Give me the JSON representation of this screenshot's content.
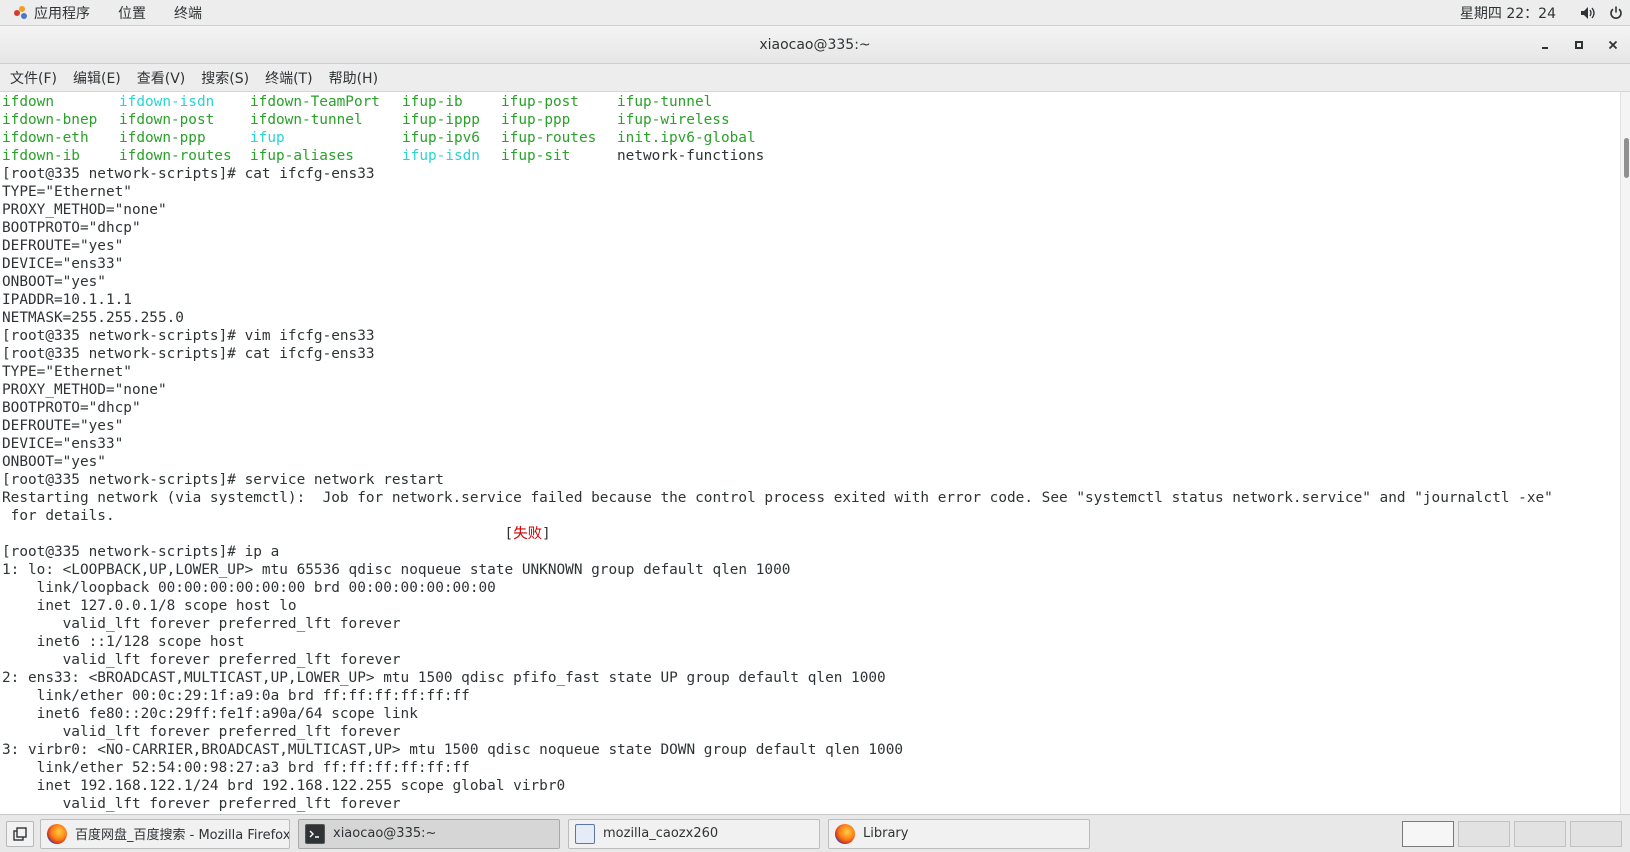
{
  "topbar": {
    "apps_label": "应用程序",
    "places_label": "位置",
    "terminal_label": "终端",
    "clock": "星期四 22：24"
  },
  "window": {
    "title": "xiaocao@335:~"
  },
  "menubar": [
    "文件(F)",
    "编辑(E)",
    "查看(V)",
    "搜索(S)",
    "终端(T)",
    "帮助(H)"
  ],
  "terminal": {
    "ls_rows": [
      [
        {
          "text": "ifdown",
          "color": "green"
        },
        {
          "text": "ifdown-isdn",
          "color": "cyan"
        },
        {
          "text": "ifdown-TeamPort",
          "color": "green"
        },
        {
          "text": "ifup-ib",
          "color": "green"
        },
        {
          "text": "ifup-post",
          "color": "green"
        },
        {
          "text": "ifup-tunnel",
          "color": "green"
        }
      ],
      [
        {
          "text": "ifdown-bnep",
          "color": "green"
        },
        {
          "text": "ifdown-post",
          "color": "green"
        },
        {
          "text": "ifdown-tunnel",
          "color": "green"
        },
        {
          "text": "ifup-ippp",
          "color": "green"
        },
        {
          "text": "ifup-ppp",
          "color": "green"
        },
        {
          "text": "ifup-wireless",
          "color": "green"
        }
      ],
      [
        {
          "text": "ifdown-eth",
          "color": "green"
        },
        {
          "text": "ifdown-ppp",
          "color": "green"
        },
        {
          "text": "ifup",
          "color": "cyan"
        },
        {
          "text": "ifup-ipv6",
          "color": "green"
        },
        {
          "text": "ifup-routes",
          "color": "green"
        },
        {
          "text": "init.ipv6-global",
          "color": "green"
        }
      ],
      [
        {
          "text": "ifdown-ib",
          "color": "green"
        },
        {
          "text": "ifdown-routes",
          "color": "green"
        },
        {
          "text": "ifup-aliases",
          "color": "green"
        },
        {
          "text": "ifup-isdn",
          "color": "cyan"
        },
        {
          "text": "ifup-sit",
          "color": "green"
        },
        {
          "text": "network-functions",
          "color": "plain"
        }
      ]
    ],
    "lines": [
      "[root@335 network-scripts]# cat ifcfg-ens33",
      "TYPE=\"Ethernet\"",
      "PROXY_METHOD=\"none\"",
      "BOOTPROTO=\"dhcp\"",
      "DEFROUTE=\"yes\"",
      "DEVICE=\"ens33\"",
      "ONBOOT=\"yes\"",
      "IPADDR=10.1.1.1",
      "NETMASK=255.255.255.0",
      "[root@335 network-scripts]# vim ifcfg-ens33",
      "[root@335 network-scripts]# cat ifcfg-ens33",
      "TYPE=\"Ethernet\"",
      "PROXY_METHOD=\"none\"",
      "BOOTPROTO=\"dhcp\"",
      "DEFROUTE=\"yes\"",
      "DEVICE=\"ens33\"",
      "ONBOOT=\"yes\"",
      "[root@335 network-scripts]# service network restart",
      "Restarting network (via systemctl):  Job for network.service failed because the control process exited with error code. See \"systemctl status network.service\" and \"journalctl -xe\"",
      " for details."
    ],
    "fail_status": {
      "padding": "                                                          ",
      "open": "[",
      "text": "失败",
      "close": "]"
    },
    "lines_after": [
      "[root@335 network-scripts]# ip a",
      "1: lo: <LOOPBACK,UP,LOWER_UP> mtu 65536 qdisc noqueue state UNKNOWN group default qlen 1000",
      "    link/loopback 00:00:00:00:00:00 brd 00:00:00:00:00:00",
      "    inet 127.0.0.1/8 scope host lo",
      "       valid_lft forever preferred_lft forever",
      "    inet6 ::1/128 scope host",
      "       valid_lft forever preferred_lft forever",
      "2: ens33: <BROADCAST,MULTICAST,UP,LOWER_UP> mtu 1500 qdisc pfifo_fast state UP group default qlen 1000",
      "    link/ether 00:0c:29:1f:a9:0a brd ff:ff:ff:ff:ff:ff",
      "    inet6 fe80::20c:29ff:fe1f:a90a/64 scope link",
      "       valid_lft forever preferred_lft forever",
      "3: virbr0: <NO-CARRIER,BROADCAST,MULTICAST,UP> mtu 1500 qdisc noqueue state DOWN group default qlen 1000",
      "    link/ether 52:54:00:98:27:a3 brd ff:ff:ff:ff:ff:ff",
      "    inet 192.168.122.1/24 brd 192.168.122.255 scope global virbr0",
      "       valid_lft forever preferred_lft forever"
    ]
  },
  "taskbar": {
    "tasks": [
      {
        "label": "百度网盘_百度搜索 - Mozilla Firefox",
        "icon": "firefox-icon"
      },
      {
        "label": "xiaocao@335:~",
        "icon": "terminal-icon"
      },
      {
        "label": "mozilla_caozx260",
        "icon": "document-icon"
      },
      {
        "label": "Library",
        "icon": "firefox-icon"
      }
    ]
  },
  "colors": {
    "ls_executable": "#2aa12a",
    "ls_symlink": "#2ad4d4",
    "error_text": "#cc0000"
  }
}
